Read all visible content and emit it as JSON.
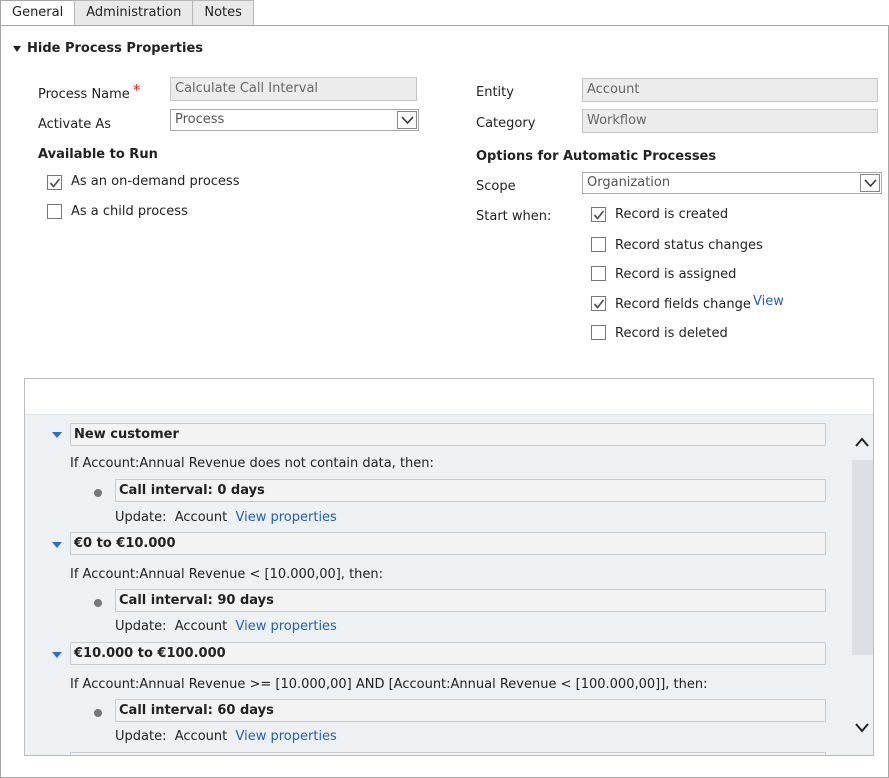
{
  "tabs": [
    "General",
    "Administration",
    "Notes"
  ],
  "section": {
    "toggle_label": "Hide Process Properties"
  },
  "form": {
    "process_name_label": "Process Name",
    "required_marker": "*",
    "process_name_value": "Calculate Call Interval",
    "activate_as_label": "Activate As",
    "activate_as_value": "Process",
    "entity_label": "Entity",
    "entity_value": "Account",
    "category_label": "Category",
    "category_value": "Workflow"
  },
  "available": {
    "title": "Available to Run",
    "on_demand_label": "As an on-demand process",
    "on_demand_checked": true,
    "child_label": "As a child process",
    "child_checked": false
  },
  "auto": {
    "title": "Options for Automatic Processes",
    "scope_label": "Scope",
    "scope_value": "Organization",
    "start_when_label": "Start when:",
    "options": [
      {
        "label": "Record is created",
        "checked": true
      },
      {
        "label": "Record status changes",
        "checked": false
      },
      {
        "label": "Record is assigned",
        "checked": false
      },
      {
        "label": "Record fields change",
        "checked": true
      },
      {
        "label": "Record is deleted",
        "checked": false
      }
    ],
    "view_link": "View"
  },
  "steps": [
    {
      "title": "New customer",
      "condition": "If Account:Annual Revenue does not contain data, then:",
      "action": "Call interval: 0 days",
      "update_label": "Update:",
      "update_entity": "Account",
      "view_props": "View properties"
    },
    {
      "title": "€0 to €10.000",
      "condition": "If Account:Annual Revenue < [10.000,00], then:",
      "action": "Call interval: 90 days",
      "update_label": "Update:",
      "update_entity": "Account",
      "view_props": "View properties"
    },
    {
      "title": "€10.000 to €100.000",
      "condition": "If Account:Annual Revenue >= [10.000,00] AND [Account:Annual Revenue < [100.000,00]], then:",
      "action": "Call interval: 60 days",
      "update_label": "Update:",
      "update_entity": "Account",
      "view_props": "View properties"
    }
  ],
  "icons": {
    "section_toggle": "triangle-down-icon",
    "dropdown": "chevron-down-icon",
    "checkbox_check": "checkmark-icon",
    "step_collapse": "blue-triangle-down-icon",
    "action_bullet": "bullet-icon",
    "scroll_up": "chevron-up-icon",
    "scroll_down": "chevron-down-icon"
  },
  "colors": {
    "link": "#1f5ebf",
    "required": "#e02020",
    "step_triangle": "#2b6fc9"
  }
}
